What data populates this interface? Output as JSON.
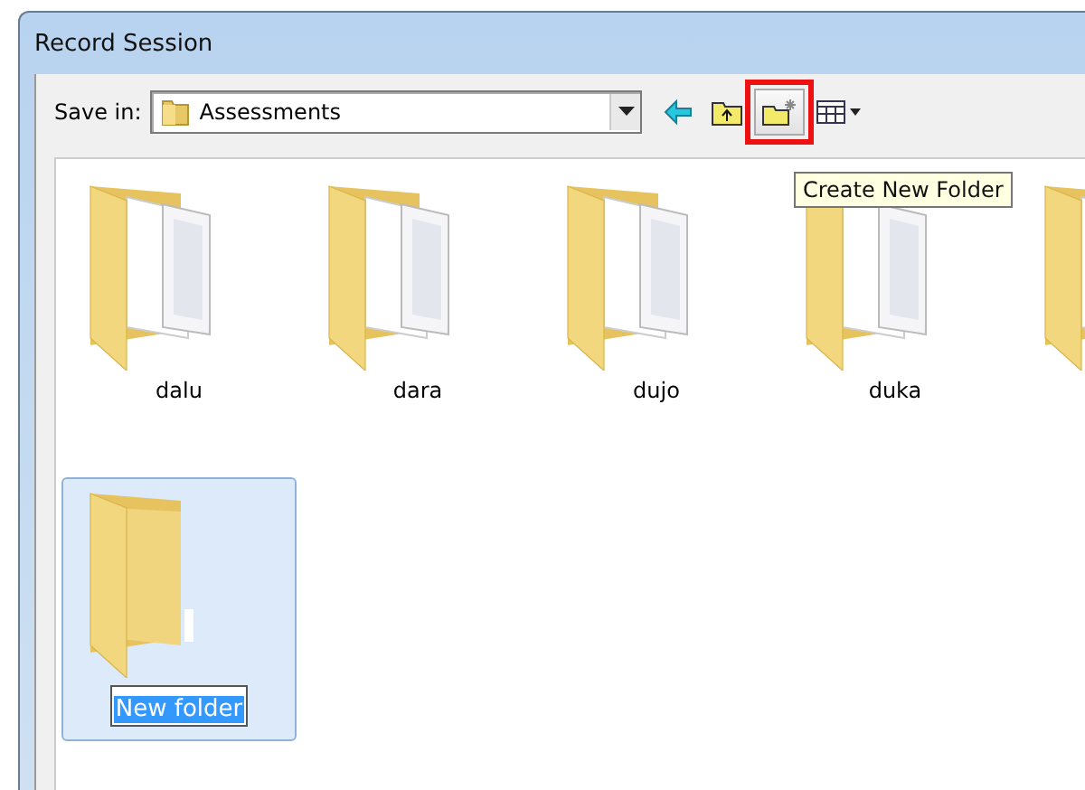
{
  "window": {
    "title": "Record Session"
  },
  "toolbar": {
    "label": "Save in:",
    "location": "Assessments",
    "buttons": [
      {
        "kind": "back",
        "highlighted": false
      },
      {
        "kind": "up",
        "highlighted": false
      },
      {
        "kind": "new-folder",
        "highlighted": true
      },
      {
        "kind": "view",
        "highlighted": false
      }
    ]
  },
  "tooltip": "Create New Folder",
  "items": [
    {
      "name": "dalu",
      "kind": "docs",
      "selected": false,
      "renaming": false
    },
    {
      "name": "dara",
      "kind": "docs",
      "selected": false,
      "renaming": false
    },
    {
      "name": "dujo",
      "kind": "docs",
      "selected": false,
      "renaming": false
    },
    {
      "name": "duka",
      "kind": "docs",
      "selected": false,
      "renaming": false
    },
    {
      "kind": "docs",
      "selected": false
    },
    {
      "name": "New folder",
      "kind": "empty",
      "selected": true,
      "renaming": true
    }
  ]
}
